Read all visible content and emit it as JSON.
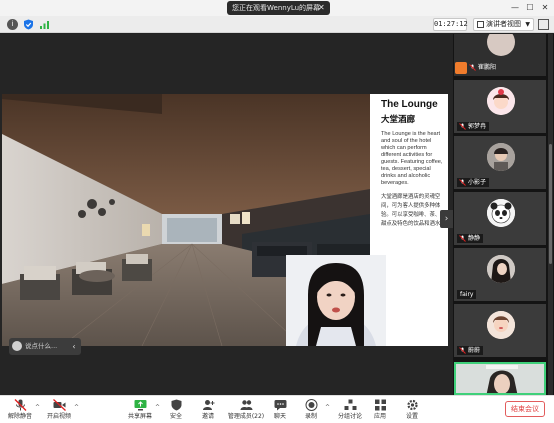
{
  "window": {
    "title": "您正在观看WennyLu的屏幕",
    "timer": "01:27:12",
    "view_button": "演讲者视图"
  },
  "slide": {
    "title": "The Lounge",
    "title_cn": "大堂酒廊",
    "body_en": "The Lounge is the heart and soul of the hotel which can perform different activities for guests. Featuring coffee, tea, dessert, special drinks and alcoholic beverages.",
    "body_cn": [
      "大堂酒廊是酒店的灵魂空",
      "间，可为客人提供多种体",
      "验。可以享受咖啡、茶、",
      "甜点及特色的饮品和酒水"
    ]
  },
  "chat": {
    "placeholder": "说点什么..."
  },
  "participants": [
    {
      "name": ""
    },
    {
      "name": "崔鹏阳"
    },
    {
      "name": "郭梦冉"
    },
    {
      "name": "小影子"
    },
    {
      "name": "静静"
    },
    {
      "name": "fairy"
    },
    {
      "name": "蔚蔚"
    },
    {
      "name": ""
    }
  ],
  "toolbar": {
    "mute": "解除静音",
    "video": "开启视频",
    "share": "共享屏幕",
    "security": "安全",
    "invite": "邀请",
    "participants": "管理成员(22)",
    "chat": "聊天",
    "record": "录制",
    "breakout": "分组讨论",
    "apps": "应用",
    "settings": "设置",
    "end": "结束会议"
  },
  "colors": {
    "accent_blue": "#1a73e8",
    "signal_green": "#2fb344",
    "end_red": "#e04040",
    "muted_red": "#e02020"
  },
  "icons": {
    "shield": "shield-icon",
    "signal": "signal-bars-icon",
    "mic_off": "mic-muted-icon",
    "video_off": "video-off-icon"
  }
}
